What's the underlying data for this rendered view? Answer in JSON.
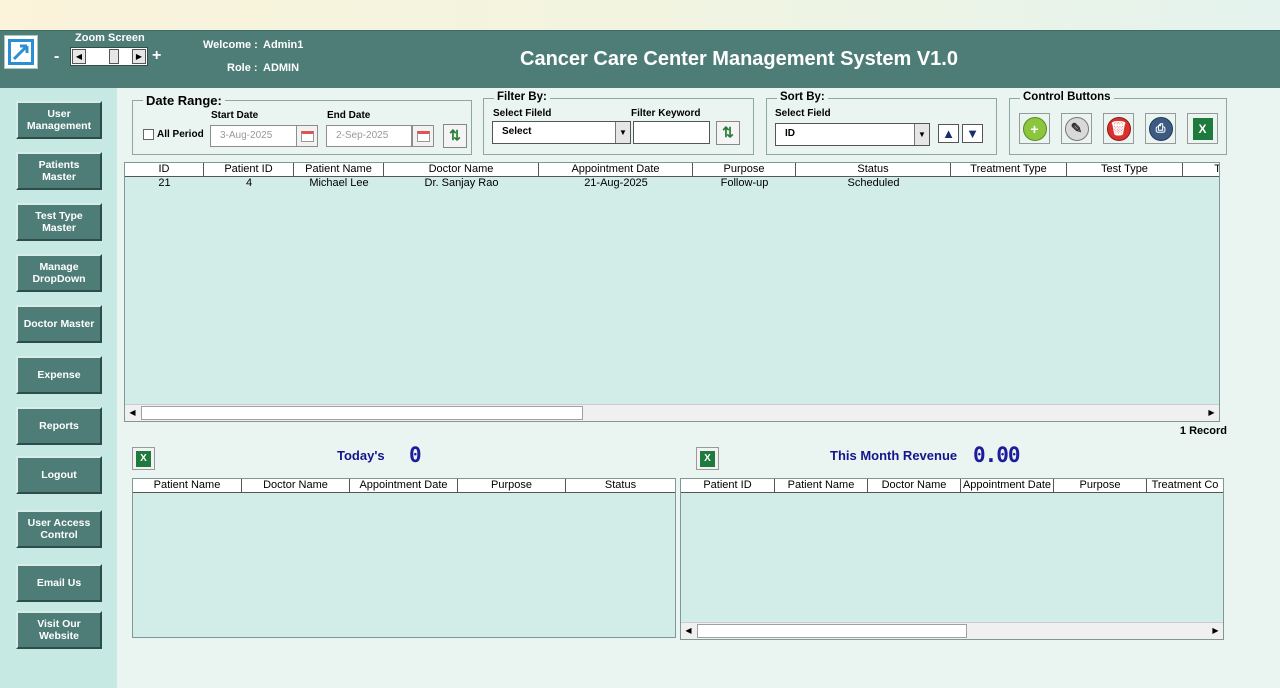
{
  "header": {
    "zoom_label": "Zoom Screen",
    "zoom_minus": "-",
    "zoom_plus": "+",
    "welcome_label": "Welcome :",
    "welcome_value": "Admin1",
    "role_label": "Role :",
    "role_value": "ADMIN",
    "title": "Cancer Care Center Management System V1.0"
  },
  "sidebar": {
    "items": [
      {
        "label": "User\nManagement"
      },
      {
        "label": "Patients\nMaster"
      },
      {
        "label": "Test Type\nMaster"
      },
      {
        "label": "Manage\nDropDown"
      },
      {
        "label": "Doctor Master"
      },
      {
        "label": "Expense"
      },
      {
        "label": "Reports"
      },
      {
        "label": "Logout"
      },
      {
        "label": "User Access\nControl"
      },
      {
        "label": "Email Us"
      },
      {
        "label": "Visit Our\nWebsite"
      }
    ]
  },
  "date_range": {
    "legend": "Date Range:",
    "all_period": "All Period",
    "start_label": "Start Date",
    "start_value": "3-Aug-2025",
    "end_label": "End Date",
    "end_value": "2-Sep-2025"
  },
  "filter": {
    "legend": "Filter By:",
    "field_label": "Select Fileld",
    "field_value": "Select",
    "keyword_label": "Filter Keyword",
    "keyword_value": ""
  },
  "sort": {
    "legend": "Sort By:",
    "field_label": "Select Field",
    "field_value": "ID"
  },
  "controls": {
    "legend": "Control Buttons"
  },
  "main_grid": {
    "columns": [
      "ID",
      "Patient ID",
      "Patient Name",
      "Doctor Name",
      "Appointment Date",
      "Purpose",
      "Status",
      "Treatment Type",
      "Test Type",
      "T"
    ],
    "rows": [
      [
        "21",
        "4",
        "Michael Lee",
        "Dr. Sanjay Rao",
        "21-Aug-2025",
        "Follow-up",
        "Scheduled",
        "",
        ""
      ]
    ],
    "record_count": "1 Record"
  },
  "today": {
    "label": "Today's",
    "value": "0",
    "columns": [
      "Patient Name",
      "Doctor Name",
      "Appointment Date",
      "Purpose",
      "Status"
    ]
  },
  "month": {
    "label": "This Month Revenue",
    "value": "0.00",
    "columns": [
      "Patient ID",
      "Patient Name",
      "Doctor Name",
      "Appointment Date",
      "Purpose",
      "Treatment Co"
    ]
  },
  "colors": {
    "header_bg": "#4e7d78",
    "sidebar_bg": "#c7e9e3",
    "grid_bg": "#d2ece8",
    "stat_text": "#14148c"
  }
}
